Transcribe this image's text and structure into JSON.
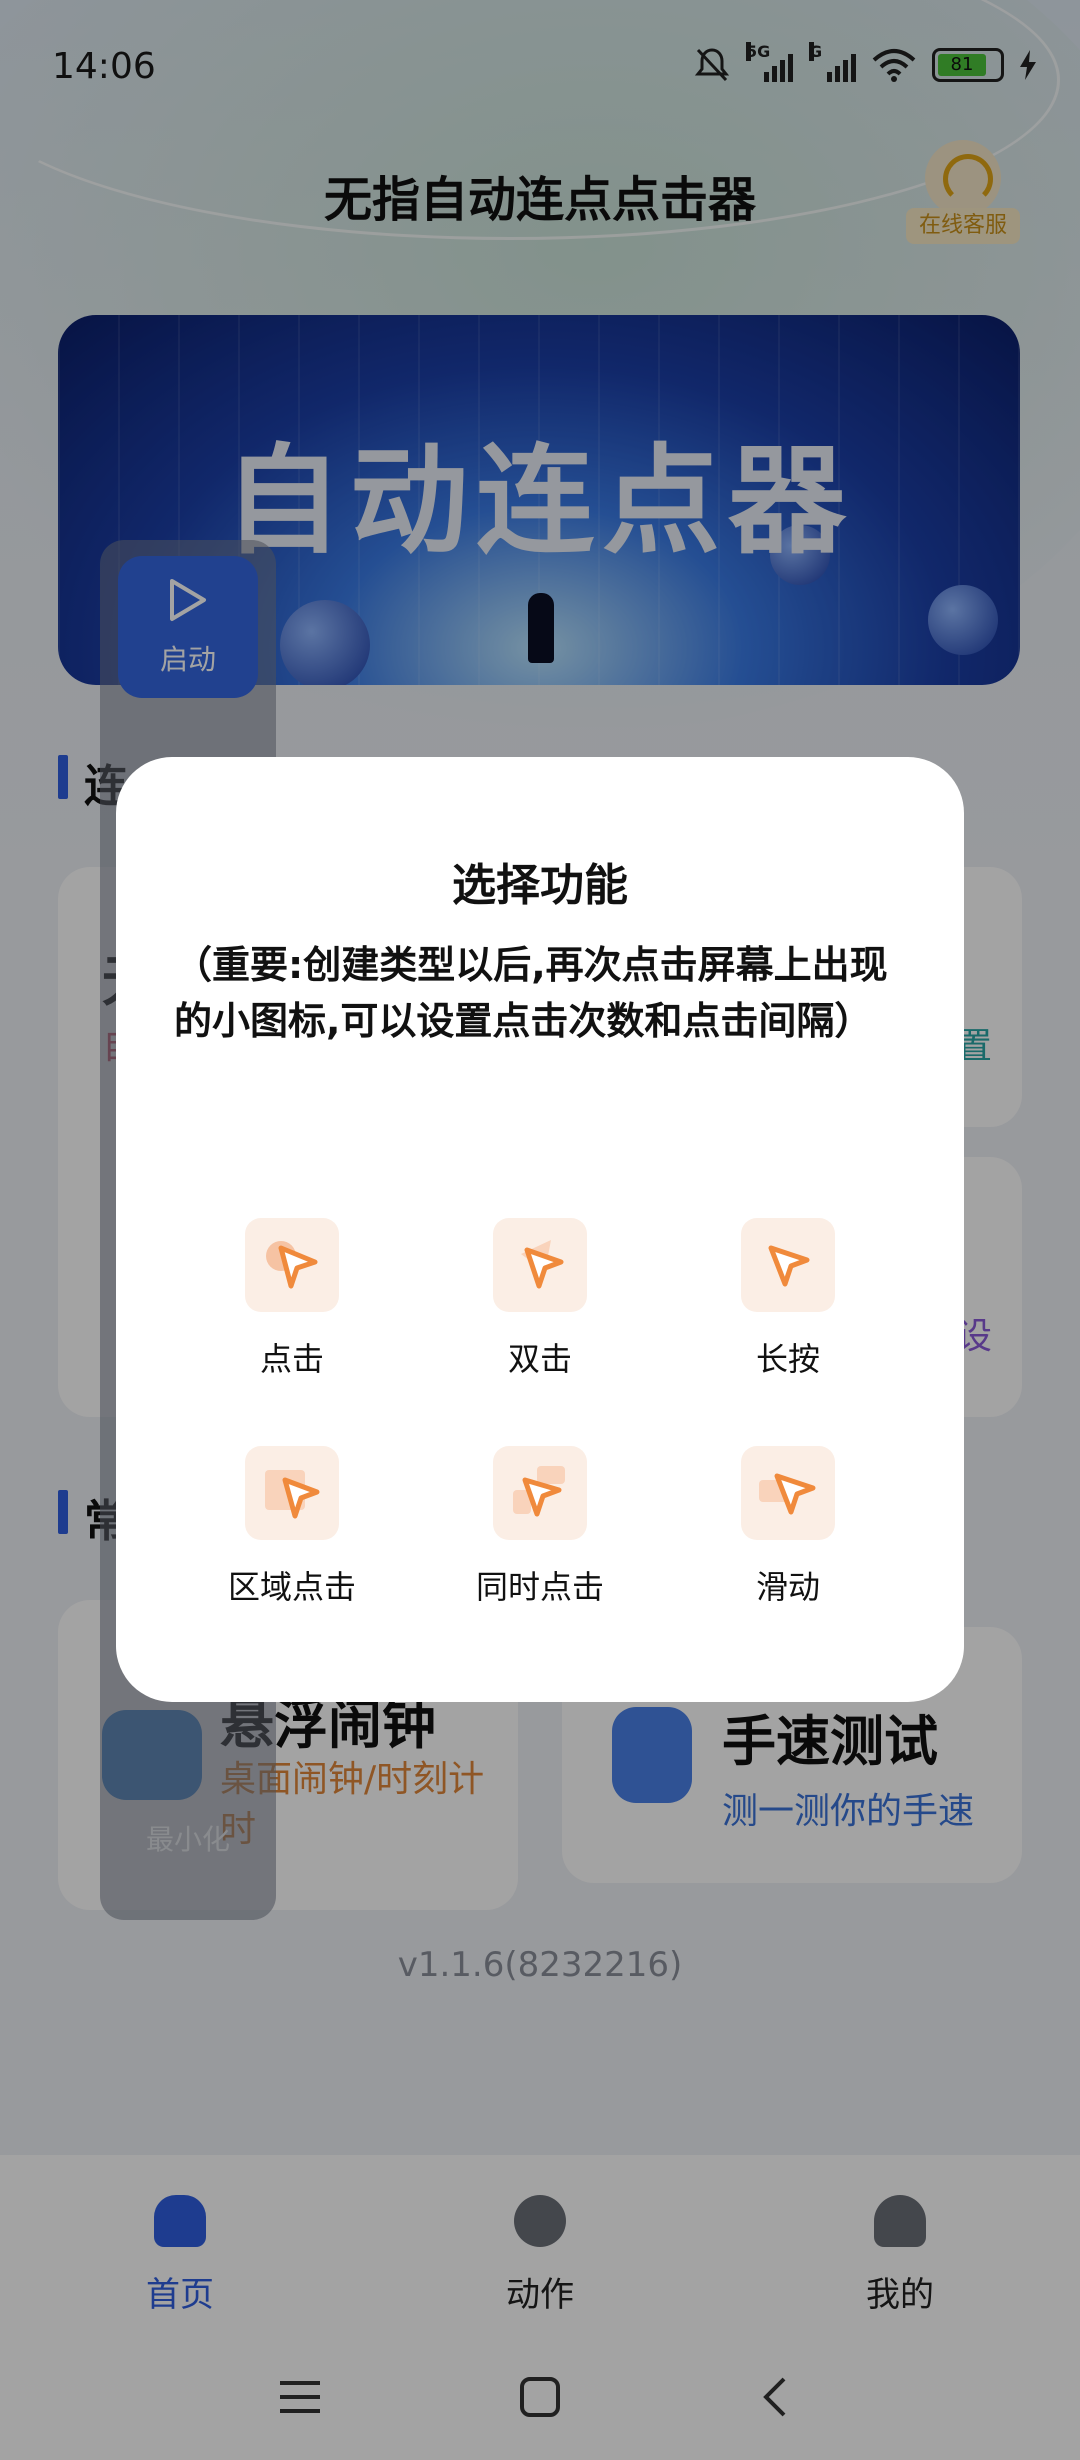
{
  "status_bar": {
    "time": "14:06",
    "network_1": "5G",
    "network_2": "G",
    "battery": "81"
  },
  "app": {
    "title": "无指自动连点点击器",
    "service_label": "在线客服"
  },
  "banner": {
    "text": "自动连点器"
  },
  "sections": {
    "first_title_partial": "连",
    "second_title_partial": "常"
  },
  "cards": {
    "card1": {
      "title_partial": "无",
      "sub_partial": "自"
    },
    "card2_right_text": "置",
    "card3_right_text": "设",
    "alarm": {
      "title": "悬浮闹钟",
      "subtitle": "桌面闹钟/时刻计时"
    },
    "speed": {
      "title": "手速测试",
      "subtitle": "测一测你的手速"
    }
  },
  "floating": {
    "start_label": "启动",
    "minimize_label": "最小化"
  },
  "version": "v1.1.6(8232216)",
  "tabs": [
    {
      "label": "首页",
      "active": true,
      "color": "#2f5fe0"
    },
    {
      "label": "动作",
      "active": false,
      "color": "#6b6f78"
    },
    {
      "label": "我的",
      "active": false,
      "color": "#6b6f78"
    }
  ],
  "dialog": {
    "title": "选择功能",
    "note": "（重要:创建类型以后,再次点击屏幕上出现的小图标,可以设置点击次数和点击间隔）",
    "options": [
      {
        "label": "点击",
        "icon": "tap-icon"
      },
      {
        "label": "双击",
        "icon": "double-tap-icon"
      },
      {
        "label": "长按",
        "icon": "long-press-icon"
      },
      {
        "label": "区域点击",
        "icon": "area-tap-icon"
      },
      {
        "label": "同时点击",
        "icon": "multi-tap-icon"
      },
      {
        "label": "滑动",
        "icon": "swipe-icon"
      }
    ]
  },
  "colors": {
    "accent": "#2f5fe0",
    "pointer": "#f08a3c",
    "tile_bg": "#fbeee5"
  }
}
